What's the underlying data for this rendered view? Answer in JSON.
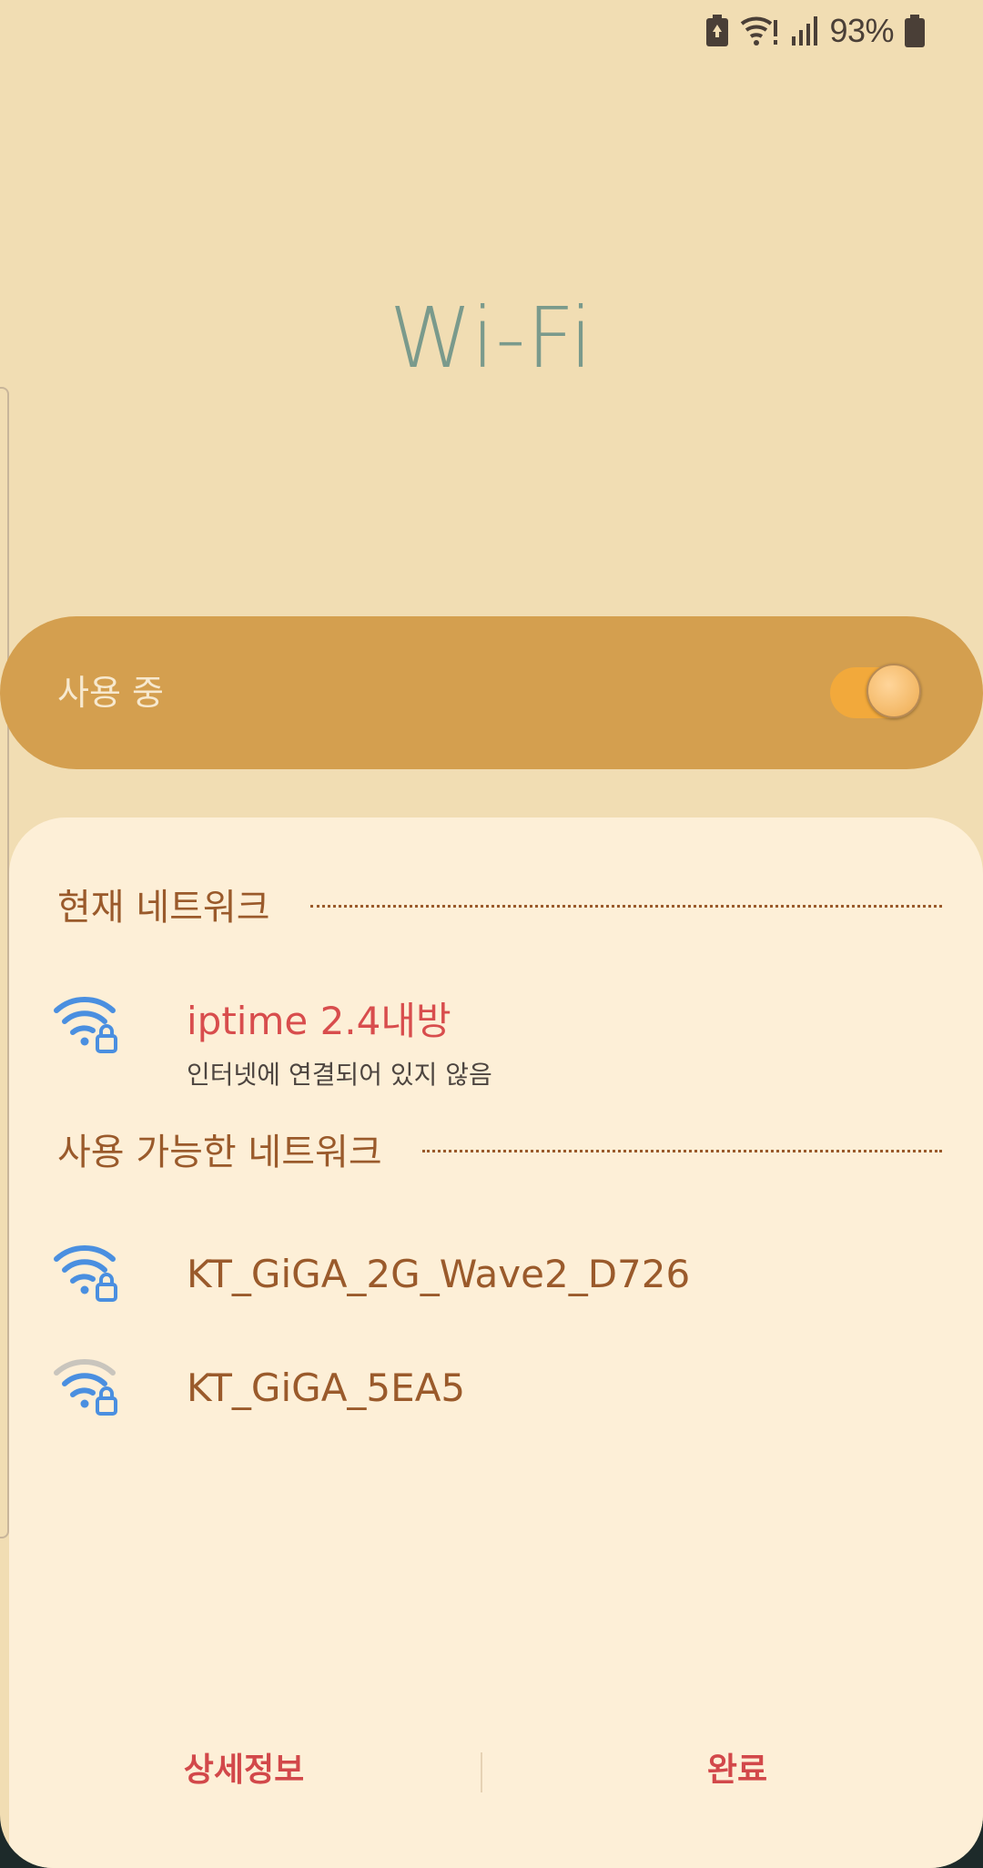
{
  "status_bar": {
    "battery_percent": "93%",
    "icons": [
      "battery-saver-icon",
      "wifi-no-internet-icon",
      "cellular-signal-icon",
      "battery-icon"
    ]
  },
  "title": "Wi-Fi",
  "wifi_toggle": {
    "label": "사용 중",
    "enabled": true
  },
  "current_network": {
    "header": "현재 네트워크",
    "items": [
      {
        "name": "iptime 2.4내방",
        "status": "인터넷에 연결되어 있지 않음",
        "icon": "wifi-locked-icon",
        "signal": "full"
      }
    ]
  },
  "available_networks": {
    "header": "사용 가능한 네트워크",
    "items": [
      {
        "name": "KT_GiGA_2G_Wave2_D726",
        "icon": "wifi-locked-icon",
        "signal": "full"
      },
      {
        "name": "KT_GiGA_5EA5",
        "icon": "wifi-locked-icon",
        "signal": "medium"
      }
    ]
  },
  "footer": {
    "details_label": "상세정보",
    "done_label": "완료"
  },
  "colors": {
    "background": "#f1ddb3",
    "panel": "#fdefd7",
    "toggle_bar": "#d49f4f",
    "switch_on": "#f2a93b",
    "accent_red": "#d84d4d",
    "network_text": "#9a5a2b",
    "wifi_icon": "#4a8fe0",
    "title": "#7a9a8c"
  }
}
